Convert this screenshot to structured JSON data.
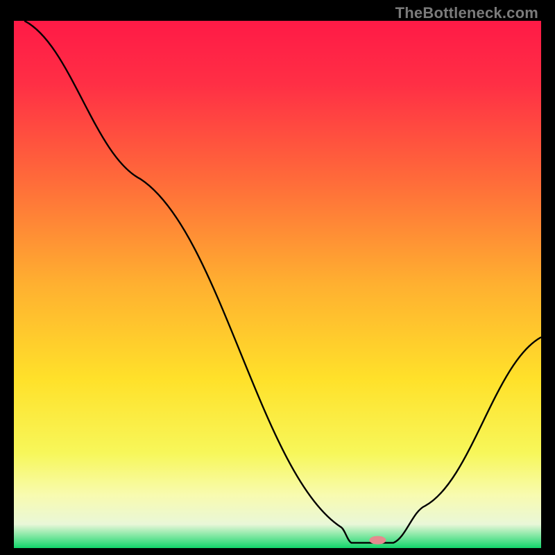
{
  "watermark": "TheBottleneck.com",
  "chart_data": {
    "type": "line",
    "title": "",
    "xlabel": "",
    "ylabel": "",
    "xlim": [
      0,
      100
    ],
    "ylim": [
      0,
      100
    ],
    "grid": false,
    "background_gradient": {
      "stops": [
        {
          "offset": 0.0,
          "color": "#ff1a46"
        },
        {
          "offset": 0.12,
          "color": "#ff2f45"
        },
        {
          "offset": 0.3,
          "color": "#ff6a3a"
        },
        {
          "offset": 0.5,
          "color": "#ffb030"
        },
        {
          "offset": 0.68,
          "color": "#ffe12a"
        },
        {
          "offset": 0.82,
          "color": "#f7f75a"
        },
        {
          "offset": 0.9,
          "color": "#f8fbb0"
        },
        {
          "offset": 0.955,
          "color": "#e9f7d8"
        },
        {
          "offset": 1.0,
          "color": "#12d66a"
        }
      ]
    },
    "series": [
      {
        "name": "bottleneck-curve",
        "color": "#000000",
        "points": [
          {
            "x": 2,
            "y": 100
          },
          {
            "x": 24,
            "y": 70
          },
          {
            "x": 62,
            "y": 4
          },
          {
            "x": 64,
            "y": 1
          },
          {
            "x": 72,
            "y": 1
          },
          {
            "x": 78,
            "y": 8
          },
          {
            "x": 100,
            "y": 40
          }
        ]
      }
    ],
    "marker": {
      "name": "selected-point",
      "color": "#e58a8e",
      "x": 69,
      "y": 1.5,
      "rx": 12,
      "ry": 6
    }
  }
}
